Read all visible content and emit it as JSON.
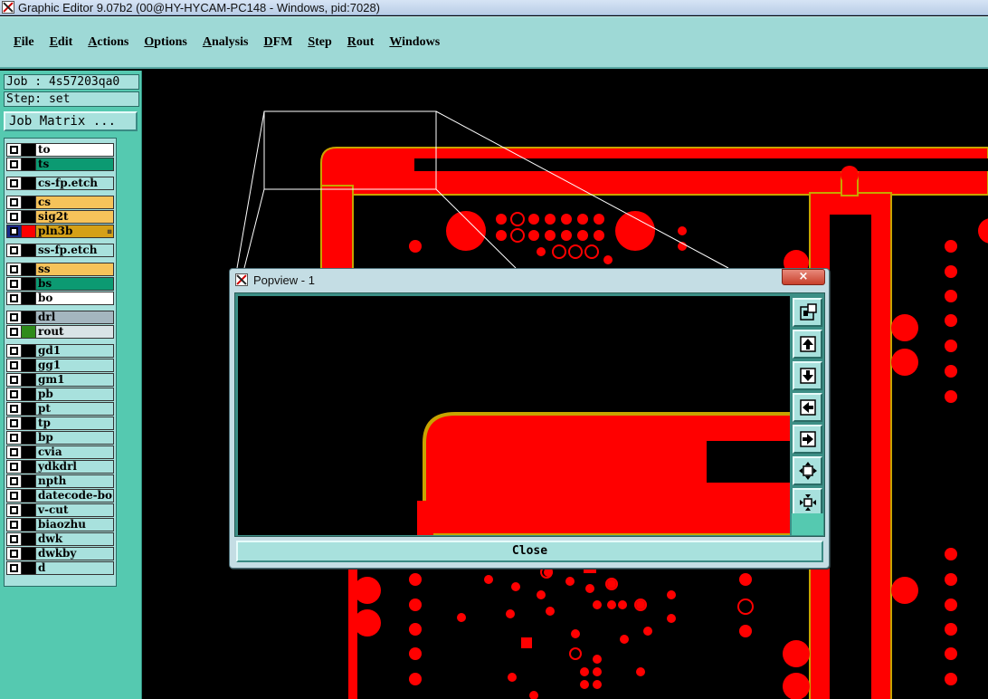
{
  "window": {
    "title": "Graphic Editor 9.07b2 (00@HY-HYCAM-PC148 - Windows, pid:7028)",
    "icon": "app-x-icon"
  },
  "menu": [
    {
      "label": "File"
    },
    {
      "label": "Edit"
    },
    {
      "label": "Actions"
    },
    {
      "label": "Options"
    },
    {
      "label": "Analysis"
    },
    {
      "label": "DFM"
    },
    {
      "label": "Step"
    },
    {
      "label": "Rout"
    },
    {
      "label": "Windows"
    }
  ],
  "job": {
    "job_text": "Job : 4s57203qa0",
    "step_text": "Step: set",
    "matrix_label": "Job Matrix ..."
  },
  "layers": [
    {
      "name": "to",
      "swatch": "#000000",
      "bg": "#ffffff"
    },
    {
      "name": "ts",
      "swatch": "#000000",
      "bg": "#0c9a72"
    },
    {
      "name": "cs-fp.etch",
      "swatch": "#000000",
      "bg": "#a8e1dd"
    },
    {
      "name": "cs",
      "swatch": "#000000",
      "bg": "#f6c35a"
    },
    {
      "name": "sig2t",
      "swatch": "#000000",
      "bg": "#f6c35a"
    },
    {
      "name": "pln3b",
      "swatch": "#ff0000",
      "bg": "#d4a017",
      "selected": true
    },
    {
      "name": "ss-fp.etch",
      "swatch": "#000000",
      "bg": "#a8e1dd"
    },
    {
      "name": "ss",
      "swatch": "#000000",
      "bg": "#f6c35a"
    },
    {
      "name": "bs",
      "swatch": "#000000",
      "bg": "#0c9a72"
    },
    {
      "name": "bo",
      "swatch": "#000000",
      "bg": "#ffffff"
    },
    {
      "name": "drl",
      "swatch": "#000000",
      "bg": "#a4b6bf"
    },
    {
      "name": "rout",
      "swatch": "#2e8b1a",
      "bg": "#d9e4e6"
    },
    {
      "name": "gd1",
      "swatch": "#000000",
      "bg": "#a8e1dd"
    },
    {
      "name": "gg1",
      "swatch": "#000000",
      "bg": "#a8e1dd"
    },
    {
      "name": "gm1",
      "swatch": "#000000",
      "bg": "#a8e1dd"
    },
    {
      "name": "pb",
      "swatch": "#000000",
      "bg": "#a8e1dd"
    },
    {
      "name": "pt",
      "swatch": "#000000",
      "bg": "#a8e1dd"
    },
    {
      "name": "tp",
      "swatch": "#000000",
      "bg": "#a8e1dd"
    },
    {
      "name": "bp",
      "swatch": "#000000",
      "bg": "#a8e1dd"
    },
    {
      "name": "cvia",
      "swatch": "#000000",
      "bg": "#a8e1dd"
    },
    {
      "name": "ydkdrl",
      "swatch": "#000000",
      "bg": "#a8e1dd"
    },
    {
      "name": "npth",
      "swatch": "#000000",
      "bg": "#a8e1dd"
    },
    {
      "name": "datecode-bo",
      "swatch": "#000000",
      "bg": "#a8e1dd"
    },
    {
      "name": "v-cut",
      "swatch": "#000000",
      "bg": "#a8e1dd"
    },
    {
      "name": "biaozhu",
      "swatch": "#000000",
      "bg": "#a8e1dd"
    },
    {
      "name": "dwk",
      "swatch": "#000000",
      "bg": "#a8e1dd"
    },
    {
      "name": "dwkby",
      "swatch": "#000000",
      "bg": "#a8e1dd"
    },
    {
      "name": "d",
      "swatch": "#000000",
      "bg": "#a8e1dd"
    }
  ],
  "popview": {
    "title": "Popview - 1",
    "close_x": "×",
    "close_label": "Close",
    "tools": [
      {
        "name": "zoom-window-icon"
      },
      {
        "name": "pan-up-icon"
      },
      {
        "name": "pan-down-icon"
      },
      {
        "name": "pan-left-icon"
      },
      {
        "name": "pan-right-icon"
      },
      {
        "name": "zoom-in-icon"
      },
      {
        "name": "zoom-out-icon"
      }
    ]
  },
  "colors": {
    "copper": "#ff0000",
    "outline": "#c8a400",
    "panel": "#a8e1dd",
    "menubar": "#9ed9d6",
    "leftpanel": "#55c9b0"
  }
}
